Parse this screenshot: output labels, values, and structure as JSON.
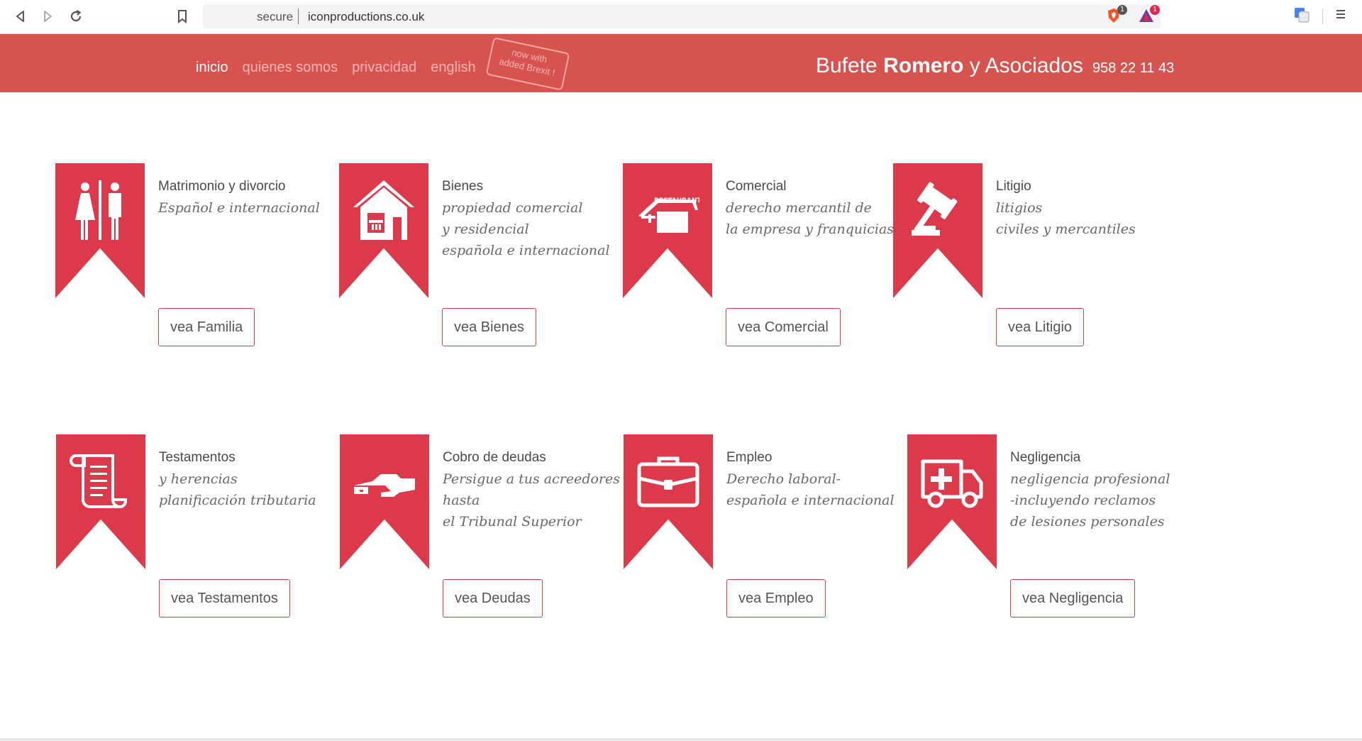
{
  "browser": {
    "url_secure": "secure",
    "url_host": "iconproductions.co.uk",
    "brave_badge": "1",
    "rewards_badge": "1"
  },
  "header": {
    "nav": [
      "inicio",
      "quienes somos",
      "privacidad",
      "english"
    ],
    "stamp_lines": [
      "now with",
      "added Brexit !"
    ],
    "brand_prefix": "Bufete",
    "brand_bold": "Romero",
    "brand_suffix": "y Asociados",
    "phone": "958 22 11 43",
    "color": "#d75350"
  },
  "services": [
    {
      "title": "Matrimonio y divorcio",
      "desc": [
        "Español e internacional"
      ],
      "button": "vea Familia",
      "icon": "restroom-icon"
    },
    {
      "title": "Bienes",
      "desc": [
        "propiedad comercial",
        "y residencial",
        "española e internacional"
      ],
      "button": "vea Bienes",
      "icon": "house-icon"
    },
    {
      "title": "Comercial",
      "desc": [
        "derecho mercantil de",
        "la empresa y franquicias"
      ],
      "button": "vea Comercial",
      "icon": "restaurant-icon",
      "icon_text": "RESTAURANTE"
    },
    {
      "title": "Litigio",
      "desc": [
        "litigios",
        "civiles y mercantiles"
      ],
      "button": "vea Litigio",
      "icon": "gavel-icon"
    },
    {
      "title": "Testamentos",
      "desc": [
        "y herencias",
        "planificación tributaria"
      ],
      "button": "vea Testamentos",
      "icon": "scroll-icon"
    },
    {
      "title": "Cobro de deudas",
      "desc": [
        "Persigue a tus acreedores",
        "hasta",
        "el Tribunal Superior"
      ],
      "button": "vea Deudas",
      "icon": "money-hand-icon"
    },
    {
      "title": "Empleo",
      "desc": [
        "Derecho laboral-",
        "española e internacional"
      ],
      "button": "vea Empleo",
      "icon": "briefcase-icon"
    },
    {
      "title": "Negligencia",
      "desc": [
        "negligencia profesional",
        "-incluyendo reclamos",
        "de lesiones personales"
      ],
      "button": "vea Negligencia",
      "icon": "ambulance-icon"
    }
  ],
  "colors": {
    "ribbon": "#dc3a4b",
    "button_border": "#dc3a4b"
  }
}
